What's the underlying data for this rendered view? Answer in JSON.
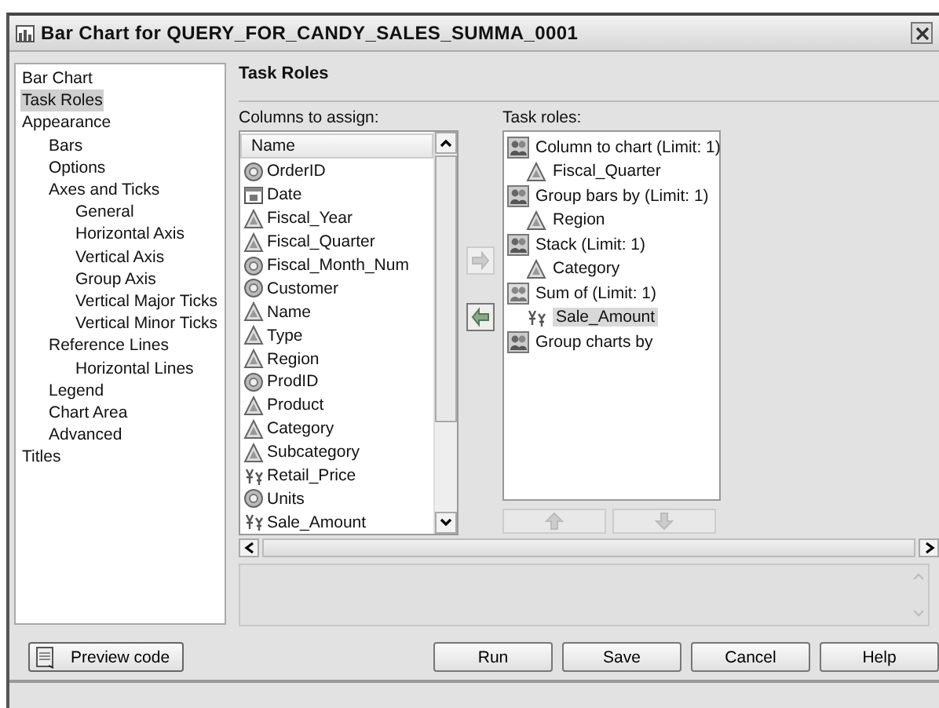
{
  "window": {
    "title": "Bar Chart for QUERY_FOR_CANDY_SALES_SUMMA_0001"
  },
  "nav": [
    {
      "label": "Bar Chart",
      "selected": false
    },
    {
      "label": "Task Roles",
      "selected": true
    },
    {
      "label": "Appearance",
      "selected": false,
      "children": [
        {
          "label": "Bars",
          "selected": false
        },
        {
          "label": "Options",
          "selected": false
        },
        {
          "label": "Axes and Ticks",
          "selected": false,
          "children": [
            {
              "label": "General",
              "selected": false
            },
            {
              "label": "Horizontal Axis",
              "selected": false
            },
            {
              "label": "Vertical Axis",
              "selected": false
            },
            {
              "label": "Group Axis",
              "selected": false
            },
            {
              "label": "Vertical Major Ticks",
              "selected": false
            },
            {
              "label": "Vertical Minor Ticks",
              "selected": false
            }
          ]
        },
        {
          "label": "Reference Lines",
          "selected": false,
          "children": [
            {
              "label": "Horizontal Lines",
              "selected": false
            }
          ]
        },
        {
          "label": "Legend",
          "selected": false
        },
        {
          "label": "Chart Area",
          "selected": false
        },
        {
          "label": "Advanced",
          "selected": false
        }
      ]
    },
    {
      "label": "Titles",
      "selected": false
    }
  ],
  "section_title": "Task Roles",
  "columns": {
    "label": "Columns to assign:",
    "header": "Name",
    "items": [
      {
        "label": "OrderID",
        "kind": "numeric"
      },
      {
        "label": "Date",
        "kind": "date"
      },
      {
        "label": "Fiscal_Year",
        "kind": "character"
      },
      {
        "label": "Fiscal_Quarter",
        "kind": "character"
      },
      {
        "label": "Fiscal_Month_Num",
        "kind": "numeric"
      },
      {
        "label": "Customer",
        "kind": "numeric"
      },
      {
        "label": "Name",
        "kind": "character"
      },
      {
        "label": "Type",
        "kind": "character"
      },
      {
        "label": "Region",
        "kind": "character"
      },
      {
        "label": "ProdID",
        "kind": "numeric"
      },
      {
        "label": "Product",
        "kind": "character"
      },
      {
        "label": "Category",
        "kind": "character"
      },
      {
        "label": "Subcategory",
        "kind": "character"
      },
      {
        "label": "Retail_Price",
        "kind": "currency"
      },
      {
        "label": "Units",
        "kind": "numeric"
      },
      {
        "label": "Sale_Amount",
        "kind": "currency"
      }
    ]
  },
  "transfer_buttons": [
    {
      "kind": "add",
      "disabled": true
    },
    {
      "kind": "remove",
      "disabled": false
    }
  ],
  "roles": {
    "label": "Task roles:",
    "items": [
      {
        "label": "Column to chart  (Limit: 1)",
        "kind": "role",
        "children": [
          {
            "label": "Fiscal_Quarter",
            "kind": "character",
            "selected": false
          }
        ]
      },
      {
        "label": "Group bars by  (Limit: 1)",
        "kind": "role",
        "children": [
          {
            "label": "Region",
            "kind": "character",
            "selected": false
          }
        ]
      },
      {
        "label": "Stack  (Limit: 1)",
        "kind": "role",
        "children": [
          {
            "label": "Category",
            "kind": "character",
            "selected": false
          }
        ]
      },
      {
        "label": "Sum of  (Limit: 1)",
        "kind": "analysis",
        "children": [
          {
            "label": "Sale_Amount",
            "kind": "currency",
            "selected": true
          }
        ]
      },
      {
        "label": "Group charts by",
        "kind": "role"
      }
    ]
  },
  "order_buttons": [
    {
      "kind": "up",
      "disabled": true
    },
    {
      "kind": "down",
      "disabled": true
    }
  ],
  "preview_button": "Preview code",
  "buttons": [
    "Run",
    "Save",
    "Cancel",
    "Help"
  ]
}
